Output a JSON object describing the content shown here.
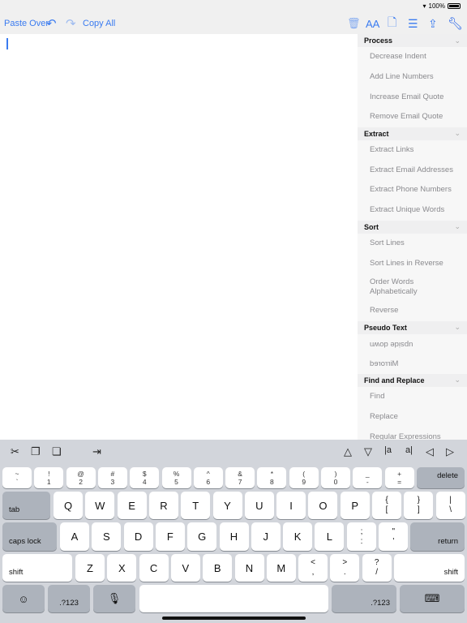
{
  "status": {
    "battery": "100%"
  },
  "toolbar": {
    "paste_over": "Paste Over",
    "copy_all": "Copy All",
    "font_size": "AA",
    "accent": "#3a7bf0"
  },
  "sidebar": {
    "sections": [
      {
        "title": "Process",
        "items": [
          "Decrease Indent",
          "Add Line Numbers",
          "Increase Email Quote",
          "Remove Email Quote"
        ]
      },
      {
        "title": "Extract",
        "items": [
          "Extract Links",
          "Extract Email Addresses",
          "Extract Phone Numbers",
          "Extract Unique Words"
        ]
      },
      {
        "title": "Sort",
        "items": [
          "Sort Lines",
          "Sort Lines in Reverse",
          "Order Words Alphabetically",
          "Reverse"
        ]
      },
      {
        "title": "Pseudo Text",
        "items": [
          "upside down",
          "Mirrored"
        ]
      },
      {
        "title": "Find and Replace",
        "items": [
          "Find",
          "Replace",
          "Regular Expressions"
        ]
      }
    ]
  },
  "keyboard": {
    "shortcut_bar": {
      "select_word_left": "|a",
      "select_word_right": "a|"
    },
    "number_row": [
      [
        "~",
        "`"
      ],
      [
        "!",
        "1"
      ],
      [
        "@",
        "2"
      ],
      [
        "#",
        "3"
      ],
      [
        "$",
        "4"
      ],
      [
        "%",
        "5"
      ],
      [
        "^",
        "6"
      ],
      [
        "&",
        "7"
      ],
      [
        "*",
        "8"
      ],
      [
        "(",
        "9"
      ],
      [
        ")",
        "0"
      ],
      [
        "_",
        "-"
      ],
      [
        "+",
        "="
      ]
    ],
    "delete": "delete",
    "tab": "tab",
    "row_q": [
      "Q",
      "W",
      "E",
      "R",
      "T",
      "Y",
      "U",
      "I",
      "O",
      "P"
    ],
    "row_q_extra": [
      [
        "{",
        "["
      ],
      [
        "}",
        "]"
      ],
      [
        "|",
        "\\"
      ]
    ],
    "caps_lock": "caps lock",
    "row_a": [
      "A",
      "S",
      "D",
      "F",
      "G",
      "H",
      "J",
      "K",
      "L"
    ],
    "row_a_extra": [
      [
        ";",
        ":"
      ],
      [
        "\"",
        "'"
      ]
    ],
    "return": "return",
    "shift": "shift",
    "row_z": [
      "Z",
      "X",
      "C",
      "V",
      "B",
      "N",
      "M"
    ],
    "row_z_extra": [
      [
        "<",
        ","
      ],
      [
        ">",
        "."
      ],
      [
        "?",
        "/"
      ]
    ],
    "numbers_toggle": ".?123"
  }
}
